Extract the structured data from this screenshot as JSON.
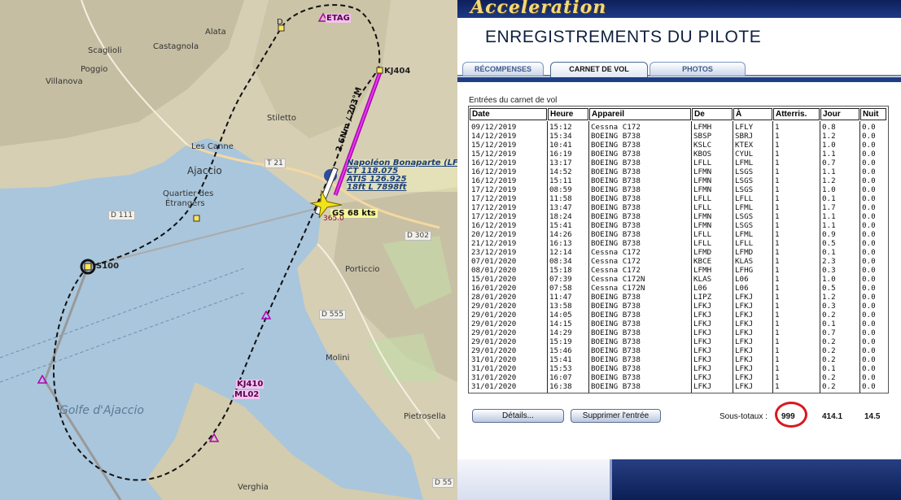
{
  "map": {
    "places": [
      {
        "name": "Alata"
      },
      {
        "name": "Castagnola"
      },
      {
        "name": "Scaglioli"
      },
      {
        "name": "Poggio"
      },
      {
        "name": "Villanova"
      },
      {
        "name": "Stiletto"
      },
      {
        "name": "Les Canne"
      },
      {
        "name": "Ajaccio"
      },
      {
        "name": "Quartier des"
      },
      {
        "name": "Étrangers"
      },
      {
        "name": "Porticcio"
      },
      {
        "name": "Molini"
      },
      {
        "name": "Pietrosella"
      },
      {
        "name": "Verghia"
      }
    ],
    "roads": [
      "T 21",
      "D 111",
      "D 302",
      "D 555",
      "D 55"
    ],
    "gulf": "Golfe d'Ajaccio",
    "waypoints": {
      "d": "D",
      "etag": "ETAG",
      "kj404": "KJ404",
      "s100": "S100",
      "kj410": "KJ410",
      "ml02": "ML02"
    },
    "leg": "2.6Nm / 203°M",
    "airport": {
      "name": "Napoléon Bonaparte (LFKJ)",
      "ct": "CT 118.075",
      "atis": "ATIS 126.925",
      "runway": "18ft L 7898ft"
    },
    "aircraft": {
      "ground_speed": "GS 68 kts",
      "altitude": "365.0"
    },
    "colors": {
      "sea": "#a9c6dc",
      "route": "#111111",
      "active_leg": "#b000b5"
    }
  },
  "panel": {
    "banner": "Acceleration",
    "title": "ENREGISTREMENTS DU PILOTE",
    "tabs": [
      {
        "label": "RÉCOMPENSES",
        "active": false
      },
      {
        "label": "CARNET DE VOL",
        "active": true
      },
      {
        "label": "PHOTOS",
        "active": false
      }
    ],
    "log_caption": "Entrées du carnet de vol",
    "columns": [
      "Date",
      "Heure",
      "Appareil",
      "De",
      "À",
      "Atterris.",
      "Jour",
      "Nuit"
    ],
    "rows": [
      [
        "09/12/2019",
        "15:12",
        "Cessna C172",
        "LFMH",
        "LFLY",
        "1",
        "0.8",
        "0.0"
      ],
      [
        "14/12/2019",
        "15:34",
        "BOEING B738",
        "SBSP",
        "SBRJ",
        "1",
        "1.2",
        "0.0"
      ],
      [
        "15/12/2019",
        "10:41",
        "BOEING B738",
        "KSLC",
        "KTEX",
        "1",
        "1.0",
        "0.0"
      ],
      [
        "15/12/2019",
        "16:19",
        "BOEING B738",
        "KBOS",
        "CYUL",
        "1",
        "1.1",
        "0.0"
      ],
      [
        "16/12/2019",
        "13:17",
        "BOEING B738",
        "LFLL",
        "LFML",
        "1",
        "0.7",
        "0.0"
      ],
      [
        "16/12/2019",
        "14:52",
        "BOEING B738",
        "LFMN",
        "LSGS",
        "1",
        "1.1",
        "0.0"
      ],
      [
        "16/12/2019",
        "15:11",
        "BOEING B738",
        "LFMN",
        "LSGS",
        "1",
        "1.2",
        "0.0"
      ],
      [
        "17/12/2019",
        "08:59",
        "BOEING B738",
        "LFMN",
        "LSGS",
        "1",
        "1.0",
        "0.0"
      ],
      [
        "17/12/2019",
        "11:58",
        "BOEING B738",
        "LFLL",
        "LFLL",
        "1",
        "0.1",
        "0.0"
      ],
      [
        "17/12/2019",
        "13:47",
        "BOEING B738",
        "LFLL",
        "LFML",
        "1",
        "1.7",
        "0.0"
      ],
      [
        "17/12/2019",
        "18:24",
        "BOEING B738",
        "LFMN",
        "LSGS",
        "1",
        "1.1",
        "0.0"
      ],
      [
        "16/12/2019",
        "15:41",
        "BOEING B738",
        "LFMN",
        "LSGS",
        "1",
        "1.1",
        "0.0"
      ],
      [
        "20/12/2019",
        "14:26",
        "BOEING B738",
        "LFLL",
        "LFML",
        "1",
        "0.9",
        "0.0"
      ],
      [
        "21/12/2019",
        "16:13",
        "BOEING B738",
        "LFLL",
        "LFLL",
        "1",
        "0.5",
        "0.0"
      ],
      [
        "23/12/2019",
        "12:14",
        "Cessna C172",
        "LFMD",
        "LFMD",
        "1",
        "0.1",
        "0.0"
      ],
      [
        "07/01/2020",
        "08:34",
        "Cessna C172",
        "KBCE",
        "KLAS",
        "1",
        "2.3",
        "0.0"
      ],
      [
        "08/01/2020",
        "15:18",
        "Cessna C172",
        "LFMH",
        "LFHG",
        "1",
        "0.3",
        "0.0"
      ],
      [
        "15/01/2020",
        "07:39",
        "Cessna C172N",
        "KLAS",
        "L06",
        "1",
        "1.0",
        "0.0"
      ],
      [
        "16/01/2020",
        "07:58",
        "Cessna C172N",
        "L06",
        "L06",
        "1",
        "0.5",
        "0.0"
      ],
      [
        "28/01/2020",
        "11:47",
        "BOEING B738",
        "LIPZ",
        "LFKJ",
        "1",
        "1.2",
        "0.0"
      ],
      [
        "29/01/2020",
        "13:58",
        "BOEING B738",
        "LFKJ",
        "LFKJ",
        "1",
        "0.3",
        "0.0"
      ],
      [
        "29/01/2020",
        "14:05",
        "BOEING B738",
        "LFKJ",
        "LFKJ",
        "1",
        "0.2",
        "0.0"
      ],
      [
        "29/01/2020",
        "14:15",
        "BOEING B738",
        "LFKJ",
        "LFKJ",
        "1",
        "0.1",
        "0.0"
      ],
      [
        "29/01/2020",
        "14:29",
        "BOEING B738",
        "LFKJ",
        "LFKJ",
        "1",
        "0.7",
        "0.0"
      ],
      [
        "29/01/2020",
        "15:19",
        "BOEING B738",
        "LFKJ",
        "LFKJ",
        "1",
        "0.2",
        "0.0"
      ],
      [
        "29/01/2020",
        "15:46",
        "BOEING B738",
        "LFKJ",
        "LFKJ",
        "1",
        "0.2",
        "0.0"
      ],
      [
        "31/01/2020",
        "15:41",
        "BOEING B738",
        "LFKJ",
        "LFKJ",
        "1",
        "0.2",
        "0.0"
      ],
      [
        "31/01/2020",
        "15:53",
        "BOEING B738",
        "LFKJ",
        "LFKJ",
        "1",
        "0.1",
        "0.0"
      ],
      [
        "31/01/2020",
        "16:07",
        "BOEING B738",
        "LFKJ",
        "LFKJ",
        "1",
        "0.2",
        "0.0"
      ],
      [
        "31/01/2020",
        "16:38",
        "BOEING B738",
        "LFKJ",
        "LFKJ",
        "1",
        "0.2",
        "0.0"
      ]
    ],
    "buttons": {
      "details": "Détails...",
      "delete": "Supprimer l'entrée"
    },
    "subtotals": {
      "label": "Sous-totaux :",
      "landings": "999",
      "day": "414.1",
      "night": "14.5"
    },
    "colors": {
      "banner": "#1d3a86",
      "title_gold": "#f3d97a",
      "highlight_circle": "#d9181e"
    }
  }
}
